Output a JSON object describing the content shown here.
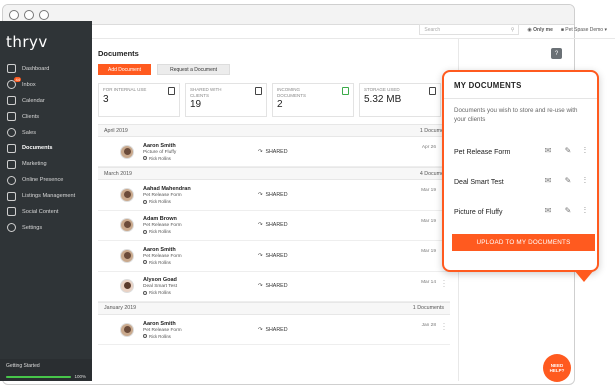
{
  "brand": {
    "logo": "thryv",
    "accent": "#ff5a1f"
  },
  "topbar": {
    "search_placeholder": "Search",
    "only_me": "Only me",
    "user": "Pet Spase Demo"
  },
  "sidebar": {
    "items": [
      {
        "label": "Dashboard",
        "icon": "dashboard-icon"
      },
      {
        "label": "Inbox",
        "icon": "inbox-icon",
        "badge": "44"
      },
      {
        "label": "Calendar",
        "icon": "calendar-icon"
      },
      {
        "label": "Clients",
        "icon": "clients-icon"
      },
      {
        "label": "Sales",
        "icon": "sales-icon"
      },
      {
        "label": "Documents",
        "icon": "documents-icon",
        "active": true
      },
      {
        "label": "Marketing",
        "icon": "marketing-icon"
      },
      {
        "label": "Online Presence",
        "icon": "globe-icon"
      },
      {
        "label": "Listings Management",
        "icon": "listings-icon"
      },
      {
        "label": "Social Content",
        "icon": "social-icon"
      },
      {
        "label": "Settings",
        "icon": "gear-icon"
      }
    ],
    "getting_started": {
      "label": "Getting Started",
      "progress": 100,
      "percent_label": "100%"
    }
  },
  "main": {
    "title": "Documents",
    "add_button": "Add Document",
    "request_button": "Request a Document",
    "stats": [
      {
        "label": "FOR INTERNAL USE",
        "value": "3",
        "icon": "lock-doc-icon"
      },
      {
        "label": "SHARED WITH CLIENTS",
        "value": "19",
        "icon": "shared-doc-icon"
      },
      {
        "label": "INCOMING DOCUMENTS",
        "value": "2",
        "icon": "incoming-doc-icon"
      },
      {
        "label": "STORAGE USED",
        "value": "5.32 MB",
        "icon": "storage-icon"
      }
    ],
    "sections": [
      {
        "month": "April 2019",
        "count": "1 Docume",
        "rows": [
          {
            "name": "Aaron Smith",
            "doc": "Picture of Fluffy",
            "by": "Rick Rollins",
            "status": "SHARED",
            "date": "Apr 26",
            "avatar": "m"
          }
        ]
      },
      {
        "month": "March 2019",
        "count": "4 Docume",
        "rows": [
          {
            "name": "Aahad Mahendran",
            "doc": "Pet Release Form",
            "by": "Rick Rollins",
            "status": "SHARED",
            "date": "Mar 19",
            "avatar": "m"
          },
          {
            "name": "Adam Brown",
            "doc": "Pet Release Form",
            "by": "Rick Rollins",
            "status": "SHARED",
            "date": "Mar 19",
            "avatar": "m"
          },
          {
            "name": "Aaron Smith",
            "doc": "Pet Release Form",
            "by": "Rick Rollins",
            "status": "SHARED",
            "date": "Mar 19",
            "avatar": "m"
          },
          {
            "name": "Alyson Goad",
            "doc": "Deal Smart Test",
            "by": "Rick Rollins",
            "status": "SHARED",
            "date": "Mar 14",
            "avatar": "f"
          }
        ]
      },
      {
        "month": "January 2019",
        "count": "1 Documents",
        "rows": [
          {
            "name": "Aaron Smith",
            "doc": "Pet Release Form",
            "by": "Rick Rollins",
            "status": "SHARED",
            "date": "Jan 28",
            "avatar": "m"
          }
        ]
      }
    ]
  },
  "popup": {
    "title": "MY DOCUMENTS",
    "description": "Documents you wish to store and re-use with your clients",
    "items": [
      {
        "label": "Pet Release Form"
      },
      {
        "label": "Deal Smart Test"
      },
      {
        "label": "Picture of Fluffy"
      }
    ],
    "upload_button": "UPLOAD TO MY DOCUMENTS"
  },
  "need_help": "NEED HELP?"
}
